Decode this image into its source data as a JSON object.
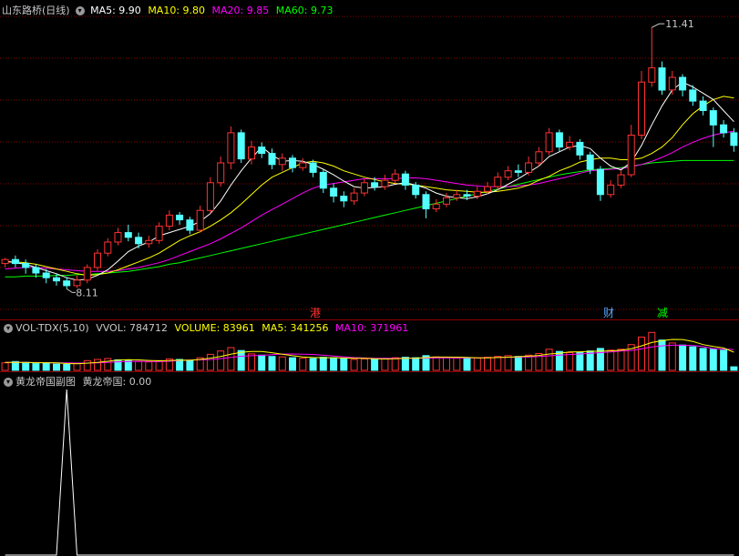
{
  "price_header": {
    "title": "山东路桥(日线)",
    "ma5": "MA5: 9.90",
    "ma10": "MA10: 9.80",
    "ma20": "MA20: 9.85",
    "ma60": "MA60: 9.73"
  },
  "volume_header": {
    "title": "VOL-TDX(5,10)",
    "vvol": "VVOL: 784712",
    "volume": "VOLUME: 83961",
    "ma5": "MA5: 341256",
    "ma10": "MA10: 371961"
  },
  "indicator_header": {
    "title": "黄龙帝国副图",
    "value": "黄龙帝国: 0.00"
  },
  "annotations": {
    "high_label": "11.41",
    "low_label": "8.11",
    "event_gang": "港",
    "event_cai": "财",
    "event_jian": "减"
  },
  "colors": {
    "up": "#ff3232",
    "down": "#54ffff",
    "ma5": "#ffffff",
    "ma10": "#ffff00",
    "ma20": "#ff00ff",
    "ma60": "#00ff00",
    "grid": "#8a0000"
  },
  "chart_data": [
    {
      "type": "candlestick",
      "title": "山东路桥(日线)",
      "ylim": [
        7.85,
        11.55
      ],
      "low_marker": 8.11,
      "high_marker": 11.41,
      "candles": [
        [
          8.43,
          8.48,
          8.5,
          8.38
        ],
        [
          8.48,
          8.43,
          8.53,
          8.38
        ],
        [
          8.43,
          8.38,
          8.48,
          8.3
        ],
        [
          8.38,
          8.31,
          8.42,
          8.25
        ],
        [
          8.31,
          8.25,
          8.36,
          8.18
        ],
        [
          8.25,
          8.21,
          8.3,
          8.15
        ],
        [
          8.21,
          8.15,
          8.26,
          8.11
        ],
        [
          8.15,
          8.22,
          8.28,
          8.12
        ],
        [
          8.22,
          8.38,
          8.42,
          8.18
        ],
        [
          8.38,
          8.56,
          8.61,
          8.34
        ],
        [
          8.56,
          8.7,
          8.75,
          8.52
        ],
        [
          8.7,
          8.82,
          8.88,
          8.66
        ],
        [
          8.82,
          8.76,
          8.92,
          8.71
        ],
        [
          8.76,
          8.68,
          8.82,
          8.62
        ],
        [
          8.68,
          8.72,
          8.78,
          8.63
        ],
        [
          8.72,
          8.9,
          8.95,
          8.68
        ],
        [
          8.9,
          9.04,
          9.1,
          8.85
        ],
        [
          9.04,
          8.98,
          9.08,
          8.92
        ],
        [
          8.98,
          8.85,
          9.02,
          8.8
        ],
        [
          8.85,
          9.1,
          9.16,
          8.82
        ],
        [
          9.1,
          9.45,
          9.52,
          9.06
        ],
        [
          9.45,
          9.7,
          9.78,
          9.4
        ],
        [
          9.7,
          10.08,
          10.16,
          9.62
        ],
        [
          10.08,
          9.75,
          10.12,
          9.7
        ],
        [
          9.75,
          9.9,
          9.98,
          9.68
        ],
        [
          9.9,
          9.82,
          9.96,
          9.76
        ],
        [
          9.82,
          9.68,
          9.88,
          9.62
        ],
        [
          9.68,
          9.76,
          9.82,
          9.6
        ],
        [
          9.76,
          9.64,
          9.8,
          9.58
        ],
        [
          9.64,
          9.7,
          9.76,
          9.6
        ],
        [
          9.7,
          9.58,
          9.74,
          9.52
        ],
        [
          9.58,
          9.38,
          9.62,
          9.32
        ],
        [
          9.38,
          9.28,
          9.44,
          9.2
        ],
        [
          9.28,
          9.22,
          9.34,
          9.14
        ],
        [
          9.22,
          9.32,
          9.38,
          9.17
        ],
        [
          9.32,
          9.45,
          9.5,
          9.28
        ],
        [
          9.45,
          9.4,
          9.52,
          9.35
        ],
        [
          9.4,
          9.48,
          9.55,
          9.36
        ],
        [
          9.48,
          9.56,
          9.62,
          9.44
        ],
        [
          9.56,
          9.42,
          9.6,
          9.36
        ],
        [
          9.42,
          9.3,
          9.46,
          9.25
        ],
        [
          9.3,
          9.12,
          9.34,
          9.0
        ],
        [
          9.12,
          9.18,
          9.24,
          9.08
        ],
        [
          9.18,
          9.26,
          9.32,
          9.14
        ],
        [
          9.26,
          9.3,
          9.36,
          9.22
        ],
        [
          9.3,
          9.28,
          9.36,
          9.23
        ],
        [
          9.28,
          9.34,
          9.4,
          9.24
        ],
        [
          9.34,
          9.4,
          9.46,
          9.3
        ],
        [
          9.4,
          9.52,
          9.58,
          9.36
        ],
        [
          9.52,
          9.6,
          9.66,
          9.48
        ],
        [
          9.6,
          9.58,
          9.68,
          9.52
        ],
        [
          9.58,
          9.7,
          9.78,
          9.54
        ],
        [
          9.7,
          9.84,
          9.9,
          9.66
        ],
        [
          9.84,
          10.08,
          10.14,
          9.8
        ],
        [
          10.08,
          9.9,
          10.12,
          9.84
        ],
        [
          9.9,
          9.96,
          10.04,
          9.86
        ],
        [
          9.96,
          9.8,
          10.0,
          9.74
        ],
        [
          9.8,
          9.62,
          9.84,
          9.56
        ],
        [
          9.62,
          9.3,
          9.66,
          9.22
        ],
        [
          9.3,
          9.42,
          9.48,
          9.26
        ],
        [
          9.42,
          9.55,
          9.6,
          9.38
        ],
        [
          9.55,
          10.05,
          10.18,
          9.52
        ],
        [
          10.05,
          10.72,
          10.86,
          10.0
        ],
        [
          10.72,
          10.9,
          11.41,
          10.66
        ],
        [
          10.9,
          10.62,
          10.98,
          10.56
        ],
        [
          10.62,
          10.78,
          10.86,
          10.56
        ],
        [
          10.78,
          10.62,
          10.82,
          10.54
        ],
        [
          10.62,
          10.48,
          10.68,
          10.42
        ],
        [
          10.48,
          10.36,
          10.54,
          10.3
        ],
        [
          10.36,
          10.18,
          10.4,
          9.9
        ],
        [
          10.18,
          10.08,
          10.24,
          10.02
        ],
        [
          10.08,
          9.92,
          10.14,
          9.84
        ]
      ],
      "series": [
        {
          "name": "MA5",
          "values": [
            8.46,
            8.44,
            8.42,
            8.38,
            8.34,
            8.3,
            8.25,
            8.22,
            8.23,
            8.28,
            8.35,
            8.46,
            8.58,
            8.65,
            8.7,
            8.78,
            8.82,
            8.86,
            8.9,
            8.96,
            9.06,
            9.22,
            9.42,
            9.6,
            9.76,
            9.9,
            9.8,
            9.72,
            9.73,
            9.72,
            9.68,
            9.62,
            9.55,
            9.47,
            9.4,
            9.38,
            9.39,
            9.4,
            9.43,
            9.45,
            9.42,
            9.38,
            9.32,
            9.28,
            9.26,
            9.25,
            9.27,
            9.31,
            9.36,
            9.43,
            9.5,
            9.58,
            9.66,
            9.78,
            9.84,
            9.9,
            9.92,
            9.88,
            9.76,
            9.66,
            9.61,
            9.71,
            9.92,
            10.18,
            10.42,
            10.62,
            10.72,
            10.66,
            10.58,
            10.5,
            10.36,
            10.22
          ]
        },
        {
          "name": "MA10",
          "values": [
            8.45,
            8.45,
            8.44,
            8.42,
            8.39,
            8.36,
            8.33,
            8.3,
            8.28,
            8.29,
            8.31,
            8.35,
            8.4,
            8.45,
            8.5,
            8.56,
            8.64,
            8.72,
            8.78,
            8.83,
            8.9,
            8.98,
            9.07,
            9.18,
            9.3,
            9.42,
            9.52,
            9.58,
            9.64,
            9.7,
            9.72,
            9.7,
            9.66,
            9.6,
            9.56,
            9.52,
            9.49,
            9.46,
            9.44,
            9.43,
            9.42,
            9.4,
            9.38,
            9.36,
            9.35,
            9.34,
            9.33,
            9.33,
            9.34,
            9.36,
            9.38,
            9.42,
            9.48,
            9.53,
            9.6,
            9.65,
            9.71,
            9.74,
            9.76,
            9.76,
            9.74,
            9.74,
            9.76,
            9.82,
            9.9,
            10.02,
            10.18,
            10.32,
            10.42,
            10.5,
            10.54,
            10.52
          ]
        },
        {
          "name": "MA20",
          "values": [
            8.36,
            8.37,
            8.38,
            8.38,
            8.37,
            8.36,
            8.35,
            8.34,
            8.33,
            8.33,
            8.33,
            8.34,
            8.36,
            8.38,
            8.41,
            8.44,
            8.48,
            8.53,
            8.58,
            8.63,
            8.68,
            8.74,
            8.81,
            8.88,
            8.96,
            9.04,
            9.11,
            9.18,
            9.25,
            9.32,
            9.38,
            9.42,
            9.44,
            9.46,
            9.48,
            9.5,
            9.5,
            9.5,
            9.5,
            9.51,
            9.51,
            9.5,
            9.48,
            9.46,
            9.44,
            9.42,
            9.41,
            9.4,
            9.4,
            9.4,
            9.41,
            9.42,
            9.44,
            9.47,
            9.5,
            9.53,
            9.57,
            9.6,
            9.61,
            9.62,
            9.63,
            9.65,
            9.68,
            9.72,
            9.77,
            9.83,
            9.9,
            9.96,
            10.01,
            10.05,
            10.08,
            10.1
          ]
        },
        {
          "name": "MA60",
          "values": [
            8.26,
            8.26,
            8.27,
            8.27,
            8.27,
            8.28,
            8.28,
            8.29,
            8.29,
            8.3,
            8.31,
            8.32,
            8.33,
            8.35,
            8.37,
            8.39,
            8.42,
            8.44,
            8.47,
            8.5,
            8.53,
            8.56,
            8.59,
            8.62,
            8.65,
            8.68,
            8.71,
            8.74,
            8.77,
            8.8,
            8.83,
            8.86,
            8.89,
            8.92,
            8.95,
            8.98,
            9.01,
            9.04,
            9.07,
            9.1,
            9.13,
            9.16,
            9.19,
            9.22,
            9.25,
            9.28,
            9.31,
            9.34,
            9.37,
            9.4,
            9.43,
            9.46,
            9.49,
            9.52,
            9.55,
            9.57,
            9.59,
            9.61,
            9.62,
            9.63,
            9.64,
            9.66,
            9.68,
            9.7,
            9.71,
            9.72,
            9.73,
            9.73,
            9.73,
            9.73,
            9.73,
            9.73
          ]
        }
      ]
    },
    {
      "type": "bar",
      "title": "VOL-TDX(5,10)",
      "values": [
        180,
        210,
        190,
        160,
        170,
        150,
        140,
        165,
        230,
        260,
        280,
        250,
        240,
        210,
        200,
        230,
        270,
        260,
        240,
        300,
        380,
        460,
        540,
        470,
        390,
        360,
        330,
        320,
        300,
        290,
        280,
        310,
        300,
        280,
        260,
        270,
        260,
        280,
        300,
        310,
        300,
        350,
        320,
        300,
        290,
        280,
        300,
        310,
        330,
        350,
        330,
        360,
        400,
        500,
        450,
        420,
        430,
        460,
        520,
        480,
        500,
        610,
        790,
        900,
        720,
        650,
        600,
        560,
        520,
        500,
        480,
        84
      ],
      "down": [
        0,
        1,
        1,
        1,
        1,
        1,
        1,
        0,
        0,
        0,
        0,
        1,
        1,
        0,
        0,
        0,
        0,
        1,
        1,
        0,
        0,
        0,
        0,
        1,
        0,
        1,
        1,
        0,
        1,
        0,
        1,
        1,
        1,
        1,
        0,
        0,
        1,
        0,
        0,
        1,
        1,
        1,
        0,
        0,
        0,
        1,
        0,
        0,
        0,
        0,
        1,
        0,
        0,
        0,
        1,
        0,
        1,
        1,
        1,
        0,
        0,
        0,
        0,
        0,
        1,
        0,
        1,
        1,
        1,
        1,
        1,
        1
      ],
      "series": [
        {
          "name": "MA5",
          "values": [
            190,
            190,
            188,
            182,
            182,
            176,
            162,
            157,
            171,
            189,
            215,
            245,
            252,
            248,
            236,
            226,
            230,
            242,
            240,
            260,
            290,
            330,
            384,
            430,
            448,
            450,
            418,
            382,
            348,
            320,
            304,
            300,
            300,
            294,
            286,
            284,
            274,
            270,
            274,
            284,
            290,
            304,
            316,
            316,
            314,
            308,
            298,
            296,
            304,
            314,
            324,
            336,
            354,
            388,
            406,
            436,
            440,
            452,
            456,
            462,
            478,
            514,
            580,
            660,
            704,
            734,
            732,
            686,
            610,
            566,
            532,
            431
          ]
        },
        {
          "name": "MA10",
          "values": [
            190,
            190,
            189,
            186,
            184,
            180,
            176,
            172,
            172,
            176,
            188,
            204,
            212,
            215,
            212,
            208,
            216,
            236,
            246,
            250,
            258,
            278,
            307,
            335,
            347,
            357,
            374,
            386,
            389,
            385,
            377,
            359,
            341,
            321,
            303,
            294,
            287,
            285,
            287,
            289,
            290,
            292,
            293,
            295,
            299,
            296,
            294,
            301,
            309,
            311,
            316,
            320,
            329,
            346,
            362,
            375,
            388,
            403,
            421,
            438,
            457,
            473,
            510,
            556,
            583,
            595,
            595,
            590,
            561,
            517,
            507,
            494
          ]
        }
      ]
    },
    {
      "type": "line",
      "title": "黄龙帝国副图",
      "ylim": [
        0,
        1
      ],
      "series": [
        {
          "name": "黄龙帝国",
          "values": [
            0,
            0,
            0,
            0,
            0,
            0,
            1,
            0,
            0,
            0,
            0,
            0,
            0,
            0,
            0,
            0,
            0,
            0,
            0,
            0,
            0,
            0,
            0,
            0,
            0,
            0,
            0,
            0,
            0,
            0,
            0,
            0,
            0,
            0,
            0,
            0,
            0,
            0,
            0,
            0,
            0,
            0,
            0,
            0,
            0,
            0,
            0,
            0,
            0,
            0,
            0,
            0,
            0,
            0,
            0,
            0,
            0,
            0,
            0,
            0,
            0,
            0,
            0,
            0,
            0,
            0,
            0,
            0,
            0,
            0,
            0,
            0
          ]
        }
      ]
    }
  ]
}
